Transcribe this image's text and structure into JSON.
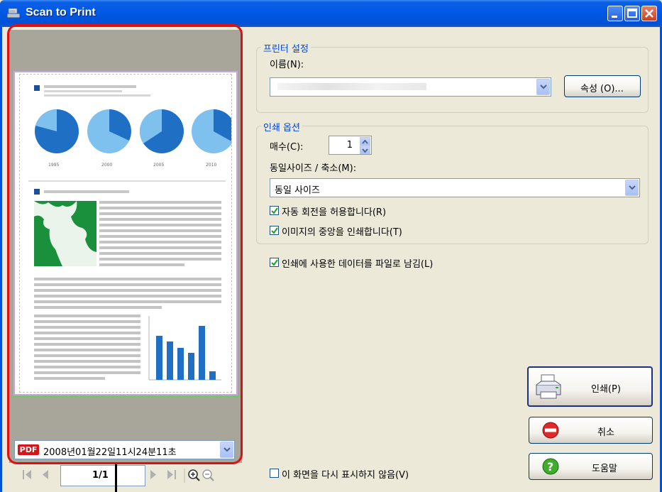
{
  "window": {
    "title": "Scan to Print"
  },
  "preview": {
    "file_name": "2008년01월22일11시24분11초",
    "file_type_badge": "PDF",
    "page_indicator": "1/1",
    "doc_year_labels": [
      "1995",
      "2000",
      "2005",
      "2010"
    ]
  },
  "printer_settings": {
    "group_title": "프린터 설정",
    "name_label": "이름(N):",
    "name_value": "",
    "properties_button": "속성 (O)..."
  },
  "print_options": {
    "group_title": "인쇄 옵션",
    "copies_label": "매수(C):",
    "copies_value": "1",
    "scale_label": "동일사이즈 / 축소(M):",
    "scale_value": "동일 사이즈",
    "auto_rotate_label": "자동 회전을 허용합니다(R)",
    "auto_rotate_checked": true,
    "center_label": "이미지의 중앙을 인쇄합니다(T)",
    "center_checked": true
  },
  "keep_file": {
    "label": "인쇄에 사용한 데이터를 파일로 남김(L)",
    "checked": true
  },
  "dont_show": {
    "label": "이 화면을 다시 표시하지 않음(V)",
    "checked": false
  },
  "buttons": {
    "print": "인쇄(P)",
    "cancel": "취소",
    "help": "도움말"
  },
  "colors": {
    "titlebar": "#0058e6",
    "highlight": "#e01010",
    "group_title": "#0046d5"
  }
}
